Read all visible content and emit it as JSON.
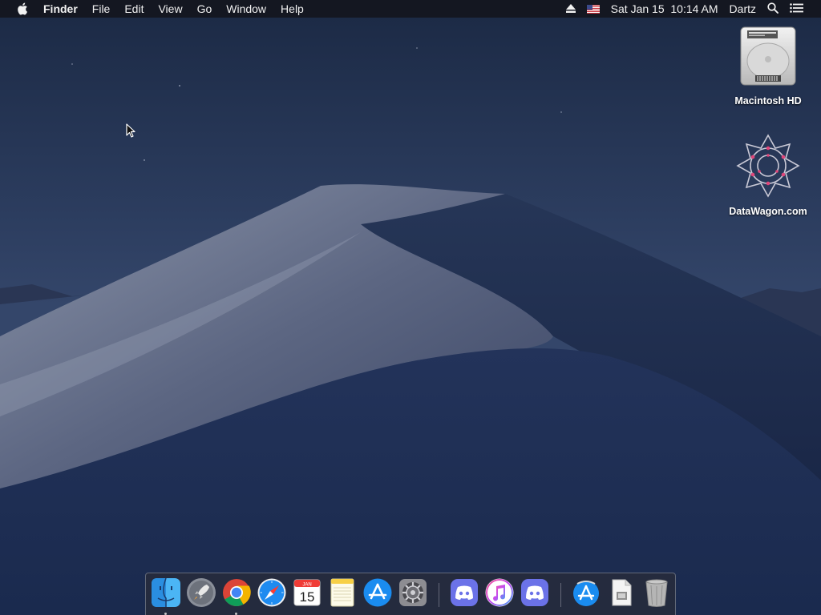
{
  "menubar": {
    "app_name": "Finder",
    "menus": [
      "File",
      "Edit",
      "View",
      "Go",
      "Window",
      "Help"
    ],
    "datetime": "Sat Jan 15  10:14 AM",
    "user": "Dartz"
  },
  "desktop": {
    "icons": [
      {
        "label": "Macintosh HD",
        "icon": "hard-drive-icon"
      },
      {
        "label": "DataWagon.com",
        "icon": "network-volume-icon"
      }
    ]
  },
  "dock": {
    "calendar": {
      "month": "JAN",
      "day": "15"
    },
    "items": [
      {
        "name": "Finder",
        "icon": "finder-icon",
        "running": true
      },
      {
        "name": "Launchpad",
        "icon": "launchpad-icon",
        "running": false
      },
      {
        "name": "Google Chrome",
        "icon": "chrome-icon",
        "running": true
      },
      {
        "name": "Safari",
        "icon": "safari-icon",
        "running": false
      },
      {
        "name": "Calendar",
        "icon": "calendar-icon",
        "running": false
      },
      {
        "name": "Notes",
        "icon": "notes-icon",
        "running": false
      },
      {
        "name": "App Store",
        "icon": "app-store-icon",
        "running": false
      },
      {
        "name": "System Preferences",
        "icon": "system-preferences-icon",
        "running": false
      },
      {
        "name": "Discord",
        "icon": "discord-icon",
        "running": false
      },
      {
        "name": "iTunes",
        "icon": "itunes-icon",
        "running": false
      },
      {
        "name": "Discord",
        "icon": "discord-icon",
        "running": false
      },
      {
        "name": "App Store Downloads",
        "icon": "app-store-folder-icon",
        "running": false
      },
      {
        "name": "Document",
        "icon": "document-icon",
        "running": false
      },
      {
        "name": "Trash",
        "icon": "trash-icon",
        "running": false
      }
    ]
  },
  "colors": {
    "menubar_bg": "#14161e",
    "accent_blue": "#1e8bf0",
    "discord_purple": "#6b72e8"
  }
}
